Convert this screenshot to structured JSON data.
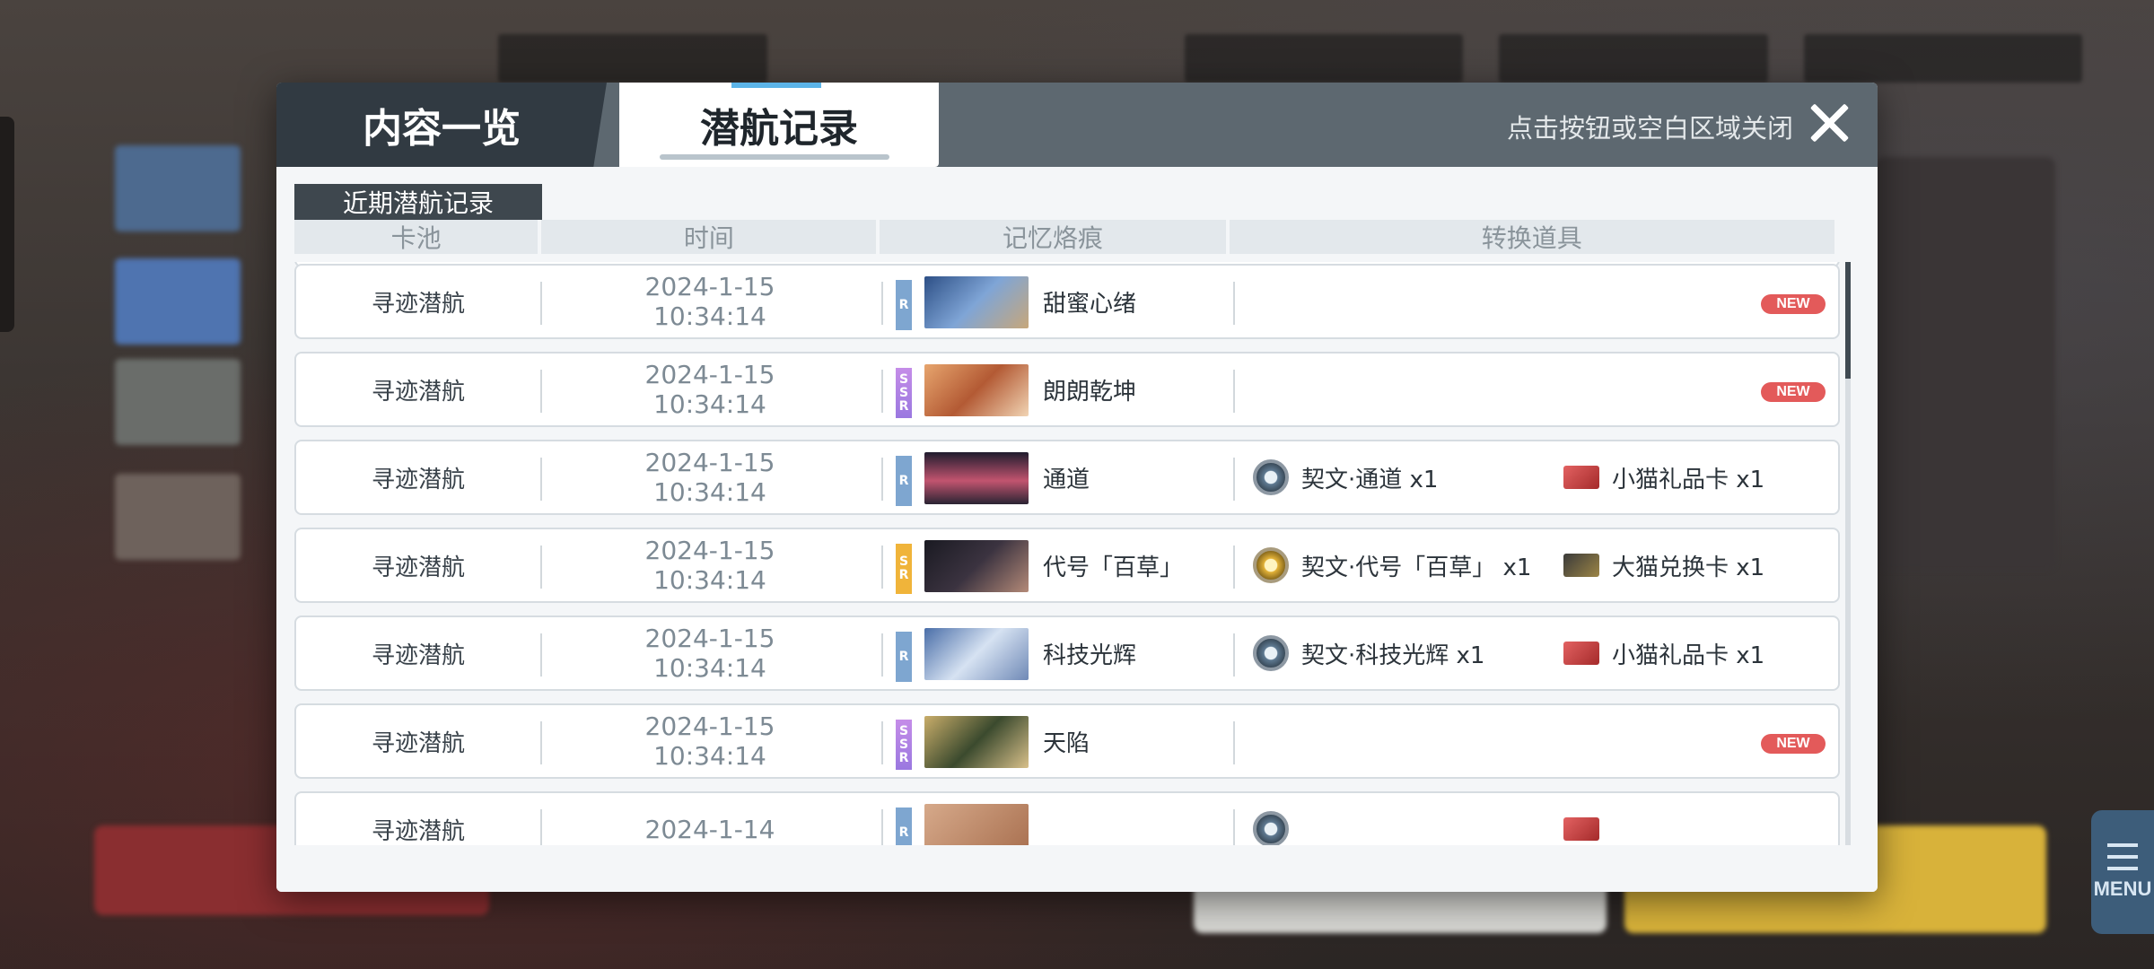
{
  "tabs": {
    "overview": "内容一览",
    "history": "潜航记录"
  },
  "close_hint": "点击按钮或空白区域关闭",
  "section_label": "近期潜航记录",
  "columns": {
    "pool": "卡池",
    "time": "时间",
    "memory": "记忆烙痕",
    "items": "转换道具"
  },
  "rows": [
    {
      "pool": "寻迹潜航",
      "date": "2024-1-15",
      "time": "10:34:14",
      "rarity": "R",
      "memory": "甜蜜心绪",
      "item1": "",
      "item2": "",
      "badge": "NEW"
    },
    {
      "pool": "寻迹潜航",
      "date": "2024-1-15",
      "time": "10:34:14",
      "rarity": "SSR",
      "memory": "朗朗乾坤",
      "item1": "",
      "item2": "",
      "badge": "NEW"
    },
    {
      "pool": "寻迹潜航",
      "date": "2024-1-15",
      "time": "10:34:14",
      "rarity": "R",
      "memory": "通道",
      "item1": "契文·通道 x1",
      "item2": "小猫礼品卡 x1",
      "badge": ""
    },
    {
      "pool": "寻迹潜航",
      "date": "2024-1-15",
      "time": "10:34:14",
      "rarity": "SR",
      "memory": "代号「百草」",
      "item1": "契文·代号「百草」 x1",
      "item2": "大猫兑换卡 x1",
      "badge": ""
    },
    {
      "pool": "寻迹潜航",
      "date": "2024-1-15",
      "time": "10:34:14",
      "rarity": "R",
      "memory": "科技光辉",
      "item1": "契文·科技光辉 x1",
      "item2": "小猫礼品卡 x1",
      "badge": ""
    },
    {
      "pool": "寻迹潜航",
      "date": "2024-1-15",
      "time": "10:34:14",
      "rarity": "SSR",
      "memory": "天陷",
      "item1": "",
      "item2": "",
      "badge": "NEW"
    },
    {
      "pool": "寻迹潜航",
      "date": "2024-1-14",
      "time": "",
      "rarity": "R",
      "memory": "",
      "item1": "",
      "item2": "",
      "badge": ""
    }
  ],
  "rarity_letters": {
    "R": "R",
    "SR_1": "S",
    "SR_2": "R",
    "SSR_1": "S",
    "SSR_2": "S",
    "SSR_3": "R"
  },
  "menu_label": "MENU",
  "colors": {
    "accent": "#5cb4e8",
    "new_badge": "#e35a5a",
    "rarity_R": "#7ea6d0",
    "rarity_SR": "#f0b43a",
    "rarity_SSR": "#b784e6"
  }
}
